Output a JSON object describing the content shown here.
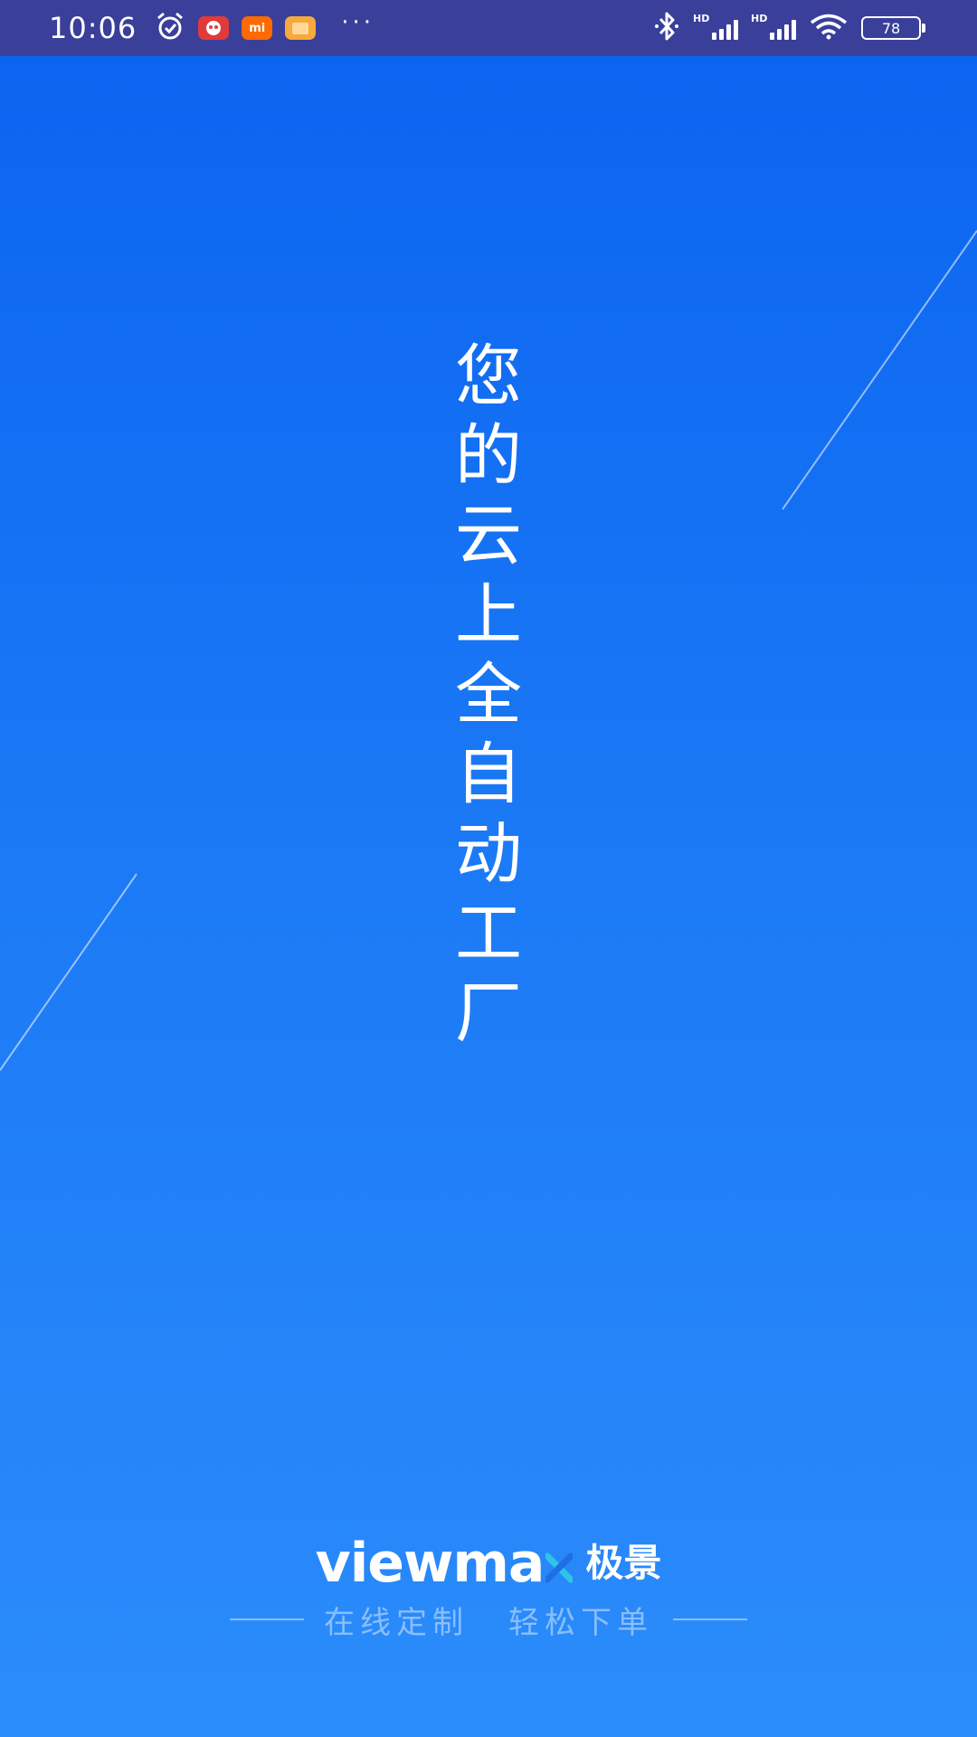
{
  "status_bar": {
    "time": "10:06",
    "battery_level": "78",
    "signal_1_label": "HD",
    "signal_2_label": "HD",
    "app_icon_orange_label": "mi",
    "icons": [
      "alarm-icon",
      "app-red-icon",
      "app-orange-icon",
      "app-yellow-icon",
      "more-icon",
      "bluetooth-icon",
      "signal-icon",
      "signal-icon",
      "wifi-icon",
      "battery-icon"
    ]
  },
  "slogan": {
    "chars": [
      "您",
      "的",
      "云",
      "上",
      "全",
      "自",
      "动",
      "工",
      "厂"
    ]
  },
  "brand": {
    "name_en": "viewma",
    "name_cn": "极景",
    "accent_color": "#2ec4e8"
  },
  "tagline": {
    "part1": "在线定制",
    "part2": "轻松下单"
  },
  "colors": {
    "background_top": "#0a63f0",
    "background_bottom": "#2b8cfb",
    "status_bar": "#3a3f9a"
  }
}
